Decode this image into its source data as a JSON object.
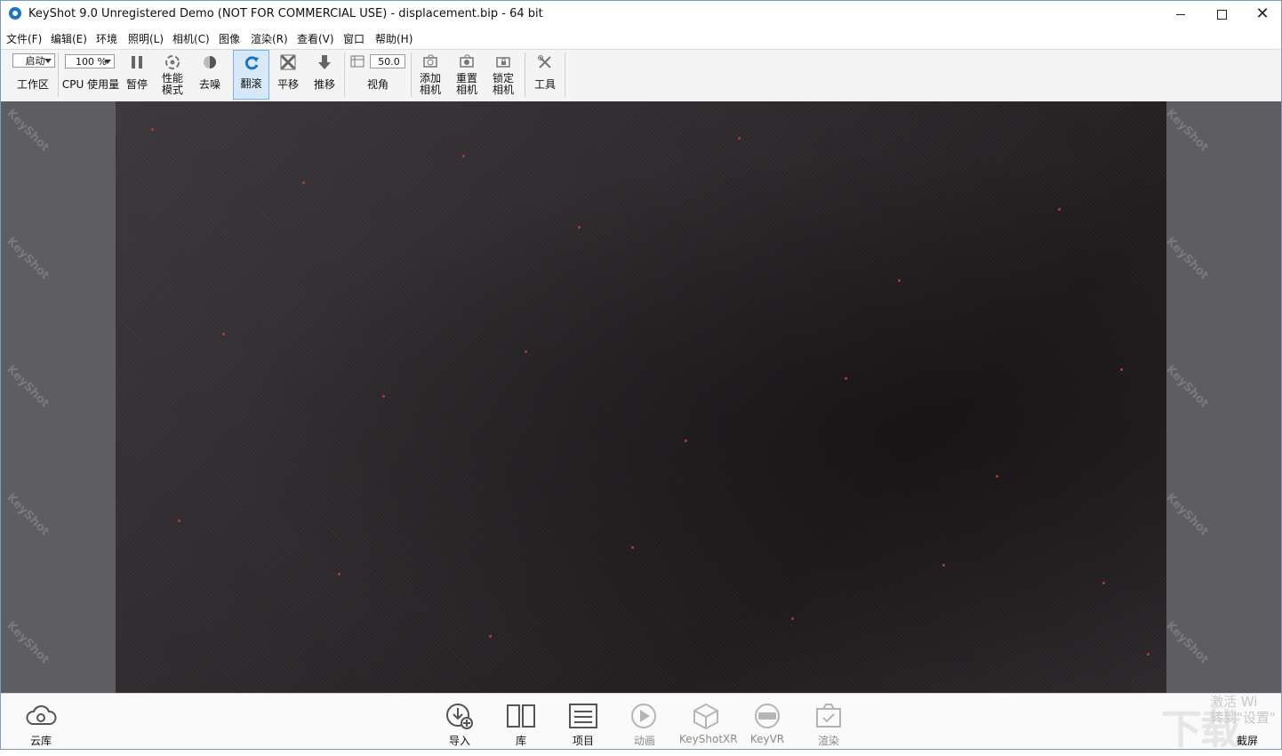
{
  "window": {
    "title": "KeyShot 9.0 Unregistered Demo (NOT FOR COMMERCIAL USE) - displacement.bip  - 64 bit",
    "close_glyph": "✕"
  },
  "menu": [
    "文件(F)",
    "编辑(E)",
    "环境",
    "照明(L)",
    "相机(C)",
    "图像",
    "渲染(R)",
    "查看(V)",
    "窗口",
    "帮助(H)"
  ],
  "toolbar": {
    "workspace_value": "启动",
    "workspace_label": "工作区",
    "cpu_value": "100 %",
    "cpu_label": "CPU 使用量",
    "pause_label": "暂停",
    "perf_label_1": "性能",
    "perf_label_2": "模式",
    "denoise_label": "去噪",
    "tumble_label": "翻滚",
    "pan_label": "平移",
    "dolly_label": "推移",
    "fov_value": "50.0",
    "fov_label": "视角",
    "add_camera_1": "添加",
    "add_camera_2": "相机",
    "reset_camera_1": "重置",
    "reset_camera_2": "相机",
    "lock_camera_1": "锁定",
    "lock_camera_2": "相机",
    "tools_label": "工具"
  },
  "viewport": {
    "watermark": "KeyShot"
  },
  "bottom": {
    "cloud_label": "云库",
    "import_label": "导入",
    "library_label": "库",
    "project_label": "项目",
    "animation_label": "动画",
    "keyshotxr_label": "KeyShotXR",
    "keyvr_label": "KeyVR",
    "render_label": "渲染",
    "screenshot_label": "截屏",
    "activate_line1": "激活 Wi",
    "activate_line2": "转到\"设置\""
  },
  "colors": {
    "accent": "#1a73c8",
    "active_tool_bg": "#d7e8f8",
    "viewport_bg": "#5e5d62",
    "render_bg": "#2a272b"
  }
}
